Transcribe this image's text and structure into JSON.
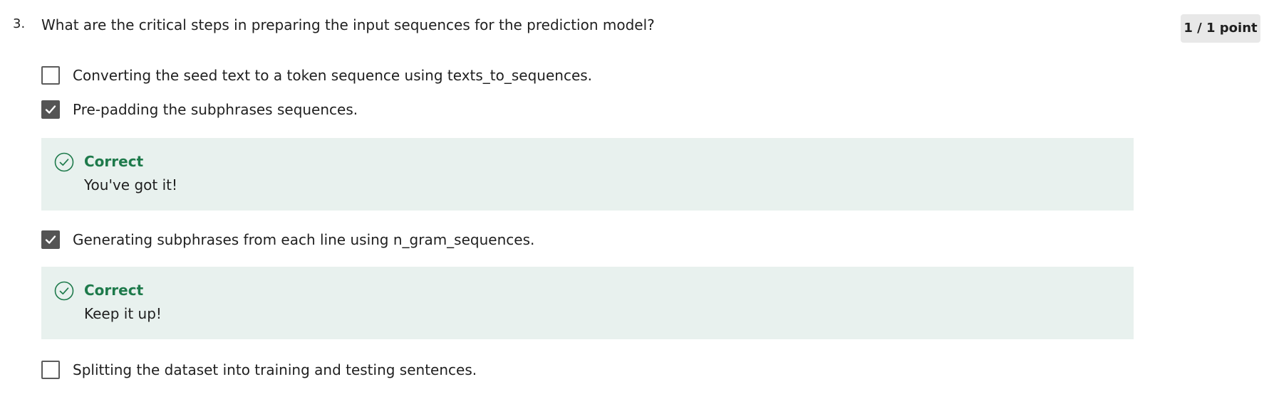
{
  "question": {
    "number": "3.",
    "text": "What are the critical steps in preparing the input sequences for the prediction model?",
    "points": "1 / 1 point"
  },
  "options": [
    {
      "label": "Converting the seed text to a token sequence using texts_to_sequences.",
      "checked": false
    },
    {
      "label": "Pre-padding the subphrases sequences.",
      "checked": true,
      "feedback": {
        "title": "Correct",
        "message": "You've got it!"
      }
    },
    {
      "label": "Generating subphrases from each line using n_gram_sequences.",
      "checked": true,
      "feedback": {
        "title": "Correct",
        "message": "Keep it up!"
      }
    },
    {
      "label": "Splitting the dataset into training and testing sentences.",
      "checked": false
    }
  ],
  "colors": {
    "correct_green": "#1e7a4b",
    "feedback_background": "#e8f1ee",
    "checkbox_checked": "#545454",
    "badge_background": "#e8e8e8"
  },
  "icons": {
    "checkbox_checked": "checkmark-icon",
    "feedback": "check-circle-icon"
  }
}
